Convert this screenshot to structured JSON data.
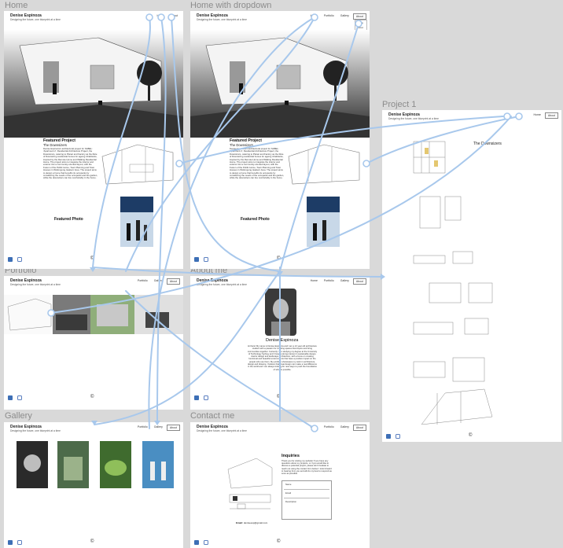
{
  "frames": {
    "home": "Home",
    "home_dropdown": "Home with dropdown",
    "project1": "Project 1",
    "portfolio": "Portfolio",
    "about": "About me",
    "gallery": "Gallery",
    "contact": "Contact me"
  },
  "site": {
    "brand": "Denise Espinoza",
    "tagline": "Designing the future, one blueprint at a time"
  },
  "nav": {
    "home": "Home",
    "about": "About",
    "portfolio": "Portfolio",
    "gallery": "Gallery"
  },
  "featured": {
    "title": "Featured Project",
    "subtitle": "The Downsizers",
    "body": "Denise Espinoza's architectural project for SABEL: 'Apartment 2', Residential Architecture Project, the Downsizers, catering to Planar and Factory as the Rule of Downsizing residential homes for ageing inhabitants, inspired by the Remote Home and Walking Residential Home. The project aims to integrate the interior and exterior into a community-oriented layout, with the Fusion of the Public Home, Town Planning and Town Houses in Wollongong, Eastern Area. The project aims to design a home that benefits its occupants by considering the needs of the occupants and the garden, while the downsizers can live comfortably in the home.",
    "photo_label": "Featured Photo"
  },
  "project": {
    "title": "The Downsizers"
  },
  "about": {
    "name": "Denise Espinoza",
    "body": "Hi there! My name is Denise Espinoza and I am a 21 year old architecture student with a passion for creating spaces that inspire and bring communities together. Currently I am studying my degree at the University of Technology Sydney and I have a strong interest in sustainable design, interior design and landscape architecture, with a focus on creating functional and beautiful environments that have a positive impact on the people who use them. My portfolio showcases my work in architecture, design and drawing. I believe that great design can make a real difference in the world and I am always looking for new ways to push the boundaries of what is possible."
  },
  "contact": {
    "title": "Inquiries",
    "body": "Thank you for visiting my website! If you have any questions about my projects, or if you would like to discuss a potential project, please don't hesitate to reach out using the contact form below. I look forward to hearing from you and will do my best to respond as soon as possible.",
    "fields": [
      "Name",
      "Email",
      "Description"
    ],
    "email_label": "Email:",
    "email": "deniseesp@gmail.com"
  },
  "footer": {
    "copyright": "©"
  },
  "colors": {
    "canvas": "#d9d9d9",
    "connector": "#a8c8ec",
    "social": "#3d6fb6"
  }
}
